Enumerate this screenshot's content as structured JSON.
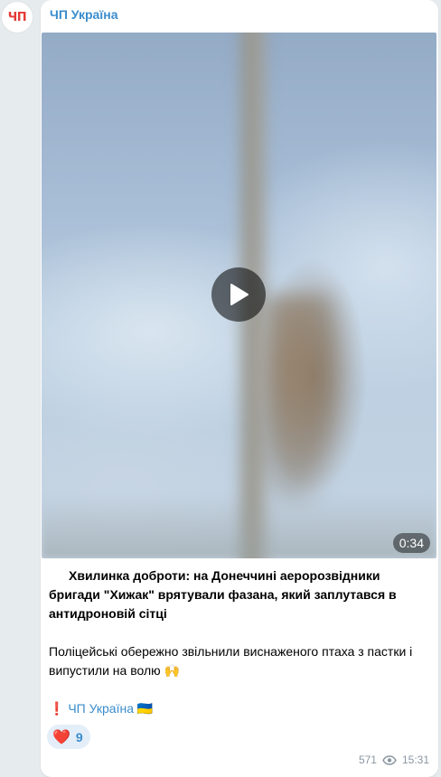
{
  "channel": {
    "avatar_text": "ЧП",
    "name": "ЧП Україна"
  },
  "video": {
    "duration": "0:34"
  },
  "post": {
    "headline": "Хвилинка доброти: на Донеччині аеророзвідники бригади \"Хижак\" врятували фазана, який заплутався в антидроновій сітці",
    "body": "Поліцейські обережно звільнили виснаженого птаха з пастки і випустили на волю 🙌",
    "signature_mark": "❗️",
    "signature_link": "ЧП Україна",
    "signature_flag": "🇺🇦"
  },
  "reactions": [
    {
      "emoji": "❤️",
      "count": "9"
    }
  ],
  "meta": {
    "views": "571",
    "time": "15:31"
  },
  "icons": {
    "play": "play-icon",
    "views": "eye-icon"
  }
}
